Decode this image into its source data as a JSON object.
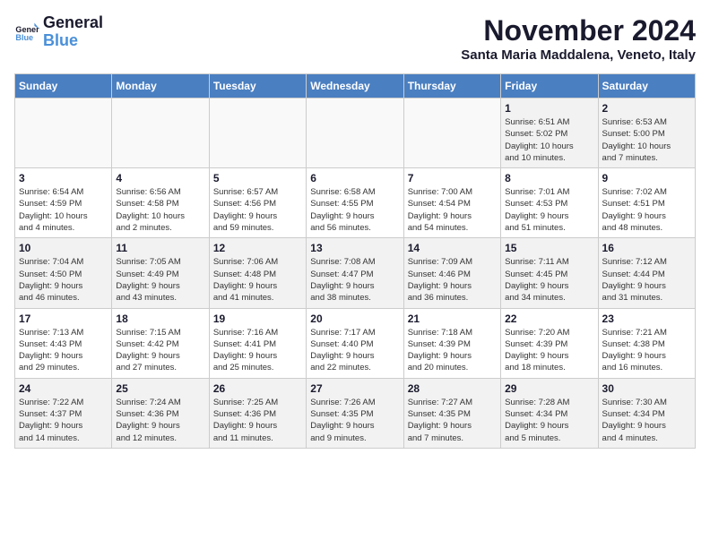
{
  "logo": {
    "line1": "General",
    "line2": "Blue"
  },
  "title": "November 2024",
  "location": "Santa Maria Maddalena, Veneto, Italy",
  "weekdays": [
    "Sunday",
    "Monday",
    "Tuesday",
    "Wednesday",
    "Thursday",
    "Friday",
    "Saturday"
  ],
  "weeks": [
    [
      {
        "day": "",
        "info": ""
      },
      {
        "day": "",
        "info": ""
      },
      {
        "day": "",
        "info": ""
      },
      {
        "day": "",
        "info": ""
      },
      {
        "day": "",
        "info": ""
      },
      {
        "day": "1",
        "info": "Sunrise: 6:51 AM\nSunset: 5:02 PM\nDaylight: 10 hours\nand 10 minutes."
      },
      {
        "day": "2",
        "info": "Sunrise: 6:53 AM\nSunset: 5:00 PM\nDaylight: 10 hours\nand 7 minutes."
      }
    ],
    [
      {
        "day": "3",
        "info": "Sunrise: 6:54 AM\nSunset: 4:59 PM\nDaylight: 10 hours\nand 4 minutes."
      },
      {
        "day": "4",
        "info": "Sunrise: 6:56 AM\nSunset: 4:58 PM\nDaylight: 10 hours\nand 2 minutes."
      },
      {
        "day": "5",
        "info": "Sunrise: 6:57 AM\nSunset: 4:56 PM\nDaylight: 9 hours\nand 59 minutes."
      },
      {
        "day": "6",
        "info": "Sunrise: 6:58 AM\nSunset: 4:55 PM\nDaylight: 9 hours\nand 56 minutes."
      },
      {
        "day": "7",
        "info": "Sunrise: 7:00 AM\nSunset: 4:54 PM\nDaylight: 9 hours\nand 54 minutes."
      },
      {
        "day": "8",
        "info": "Sunrise: 7:01 AM\nSunset: 4:53 PM\nDaylight: 9 hours\nand 51 minutes."
      },
      {
        "day": "9",
        "info": "Sunrise: 7:02 AM\nSunset: 4:51 PM\nDaylight: 9 hours\nand 48 minutes."
      }
    ],
    [
      {
        "day": "10",
        "info": "Sunrise: 7:04 AM\nSunset: 4:50 PM\nDaylight: 9 hours\nand 46 minutes."
      },
      {
        "day": "11",
        "info": "Sunrise: 7:05 AM\nSunset: 4:49 PM\nDaylight: 9 hours\nand 43 minutes."
      },
      {
        "day": "12",
        "info": "Sunrise: 7:06 AM\nSunset: 4:48 PM\nDaylight: 9 hours\nand 41 minutes."
      },
      {
        "day": "13",
        "info": "Sunrise: 7:08 AM\nSunset: 4:47 PM\nDaylight: 9 hours\nand 38 minutes."
      },
      {
        "day": "14",
        "info": "Sunrise: 7:09 AM\nSunset: 4:46 PM\nDaylight: 9 hours\nand 36 minutes."
      },
      {
        "day": "15",
        "info": "Sunrise: 7:11 AM\nSunset: 4:45 PM\nDaylight: 9 hours\nand 34 minutes."
      },
      {
        "day": "16",
        "info": "Sunrise: 7:12 AM\nSunset: 4:44 PM\nDaylight: 9 hours\nand 31 minutes."
      }
    ],
    [
      {
        "day": "17",
        "info": "Sunrise: 7:13 AM\nSunset: 4:43 PM\nDaylight: 9 hours\nand 29 minutes."
      },
      {
        "day": "18",
        "info": "Sunrise: 7:15 AM\nSunset: 4:42 PM\nDaylight: 9 hours\nand 27 minutes."
      },
      {
        "day": "19",
        "info": "Sunrise: 7:16 AM\nSunset: 4:41 PM\nDaylight: 9 hours\nand 25 minutes."
      },
      {
        "day": "20",
        "info": "Sunrise: 7:17 AM\nSunset: 4:40 PM\nDaylight: 9 hours\nand 22 minutes."
      },
      {
        "day": "21",
        "info": "Sunrise: 7:18 AM\nSunset: 4:39 PM\nDaylight: 9 hours\nand 20 minutes."
      },
      {
        "day": "22",
        "info": "Sunrise: 7:20 AM\nSunset: 4:39 PM\nDaylight: 9 hours\nand 18 minutes."
      },
      {
        "day": "23",
        "info": "Sunrise: 7:21 AM\nSunset: 4:38 PM\nDaylight: 9 hours\nand 16 minutes."
      }
    ],
    [
      {
        "day": "24",
        "info": "Sunrise: 7:22 AM\nSunset: 4:37 PM\nDaylight: 9 hours\nand 14 minutes."
      },
      {
        "day": "25",
        "info": "Sunrise: 7:24 AM\nSunset: 4:36 PM\nDaylight: 9 hours\nand 12 minutes."
      },
      {
        "day": "26",
        "info": "Sunrise: 7:25 AM\nSunset: 4:36 PM\nDaylight: 9 hours\nand 11 minutes."
      },
      {
        "day": "27",
        "info": "Sunrise: 7:26 AM\nSunset: 4:35 PM\nDaylight: 9 hours\nand 9 minutes."
      },
      {
        "day": "28",
        "info": "Sunrise: 7:27 AM\nSunset: 4:35 PM\nDaylight: 9 hours\nand 7 minutes."
      },
      {
        "day": "29",
        "info": "Sunrise: 7:28 AM\nSunset: 4:34 PM\nDaylight: 9 hours\nand 5 minutes."
      },
      {
        "day": "30",
        "info": "Sunrise: 7:30 AM\nSunset: 4:34 PM\nDaylight: 9 hours\nand 4 minutes."
      }
    ]
  ]
}
